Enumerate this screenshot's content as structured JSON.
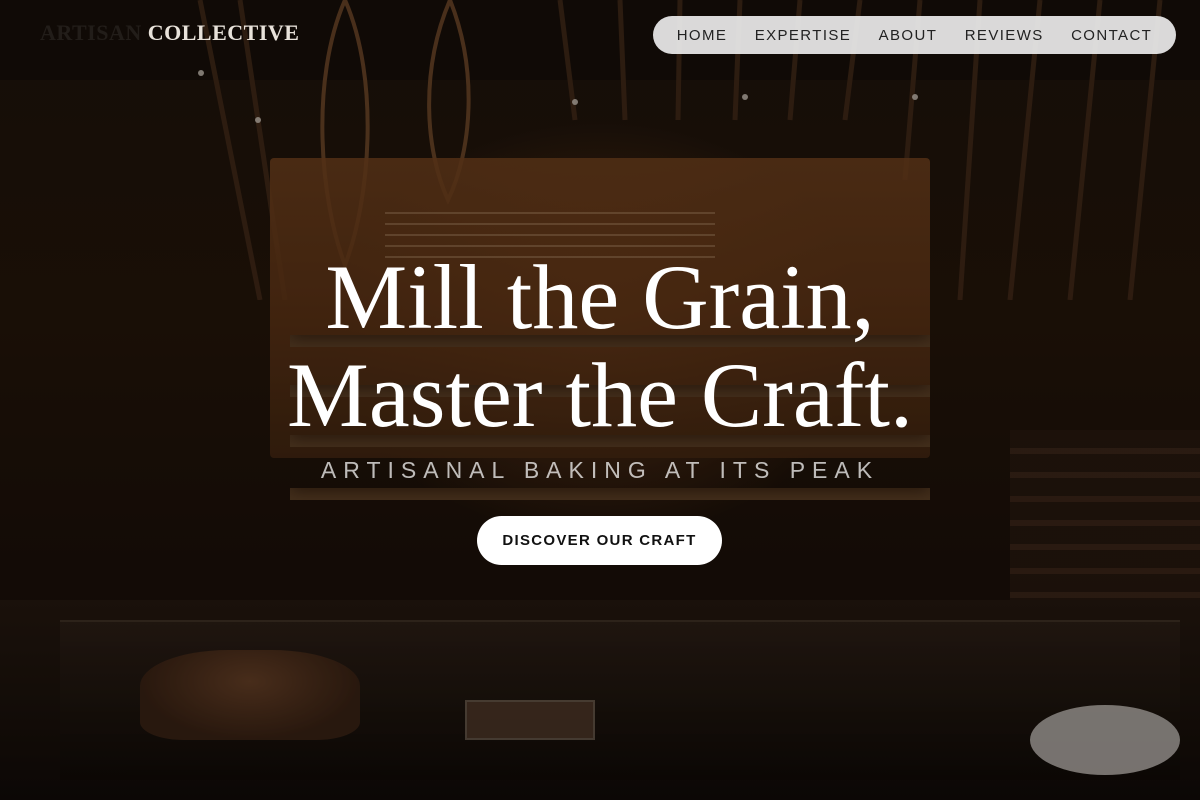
{
  "brand": {
    "faded_part": "ARTISAN",
    "name": "COLLECTIVE"
  },
  "nav": {
    "items": [
      "HOME",
      "EXPERTISE",
      "ABOUT",
      "REVIEWS",
      "CONTACT"
    ]
  },
  "hero": {
    "headline_line1": "Mill the Grain,",
    "headline_line2": "Master the Craft.",
    "subtitle": "ARTISANAL BAKING AT ITS PEAK",
    "cta_label": "DISCOVER OUR CRAFT"
  },
  "colors": {
    "nav_background": "#ebebeb",
    "cta_background": "#ffffff",
    "headline": "#ffffff"
  }
}
